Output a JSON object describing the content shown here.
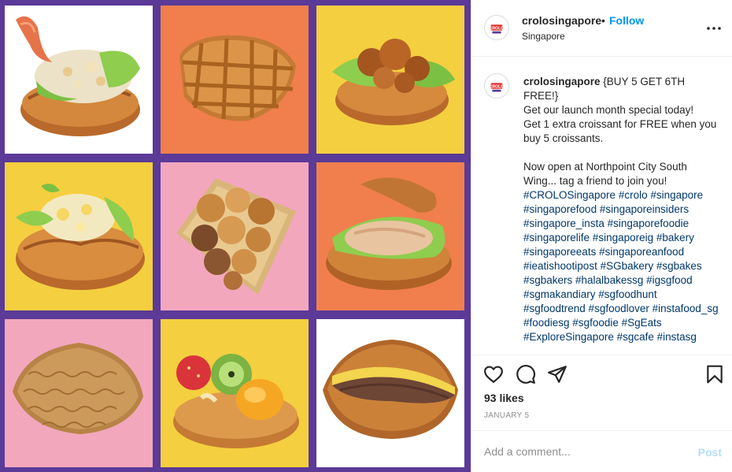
{
  "post": {
    "username": "crolosingapore",
    "separator": "•",
    "follow_label": "Follow",
    "location": "Singapore",
    "avatar_text": "CROLO",
    "caption_title": "{BUY 5 GET 6TH FREE!}",
    "caption_body": "Get our launch month special today!\nGet 1 extra croissant for FREE when you buy 5 croissants.\n\nNow open at Northpoint City South Wing... tag a friend to join you!",
    "hashtags": "#CROLOSingapore #crolo #singapore #singaporefood #singaporeinsiders #singapore_insta #singaporefoodie #singaporelife #singaporeig #bakery #singaporeeats #singaporeanfood #ieatishootipost #SGbakery #sgbakes #sgbakers #halalbakessg #igsgfood #sgmakandiary #sgfoodhunt #sgfoodtrend #sgfoodlover #instafood_sg #foodiesg #sgfoodie #SgEats #ExploreSingapore #sgcafe #instasg",
    "likes": "93 likes",
    "date": "JANUARY 5",
    "comment_placeholder": "Add a comment...",
    "post_label": "Post"
  },
  "photo": {
    "frame_color": "#5b3a98",
    "tiles": [
      {
        "bg": "#ffffff",
        "item": "shrimp-salad-croissant"
      },
      {
        "bg": "#f07f4d",
        "item": "waffle-croissant"
      },
      {
        "bg": "#f4cf3f",
        "item": "fried-chicken-croissant"
      },
      {
        "bg": "#f4cf3f",
        "item": "egg-mayo-croissant"
      },
      {
        "bg": "#f2a7bd",
        "item": "pastry-basket"
      },
      {
        "bg": "#f07f4d",
        "item": "chicken-breast-croissant"
      },
      {
        "bg": "#f2a7bd",
        "item": "chicken-floss-croissant"
      },
      {
        "bg": "#f4cf3f",
        "item": "fruit-tart-croissant"
      },
      {
        "bg": "#ffffff",
        "item": "ham-cheese-croissant"
      }
    ]
  },
  "colors": {
    "accent": "#0095f6",
    "hashtag": "#00376b",
    "muted": "#8e8e8e",
    "post_disabled": "#b2dffc"
  },
  "icons": {
    "like": "heart-icon",
    "comment": "comment-bubble-icon",
    "share": "paper-plane-icon",
    "save": "bookmark-icon",
    "more": "more-dots-icon"
  }
}
